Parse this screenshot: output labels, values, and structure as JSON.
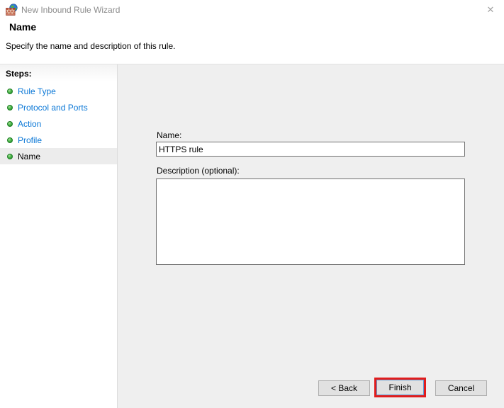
{
  "window": {
    "title": "New Inbound Rule Wizard",
    "close_glyph": "✕"
  },
  "header": {
    "title": "Name",
    "subtitle": "Specify the name and description of this rule."
  },
  "sidebar": {
    "heading": "Steps:",
    "steps": [
      {
        "label": "Rule Type",
        "current": false
      },
      {
        "label": "Protocol and Ports",
        "current": false
      },
      {
        "label": "Action",
        "current": false
      },
      {
        "label": "Profile",
        "current": false
      },
      {
        "label": "Name",
        "current": true
      }
    ]
  },
  "form": {
    "name_label": "Name:",
    "name_value": "HTTPS rule",
    "description_label": "Description (optional):",
    "description_value": ""
  },
  "buttons": {
    "back": "< Back",
    "finish": "Finish",
    "cancel": "Cancel"
  },
  "annotation": {
    "highlight_target": "finish-button",
    "color": "#e11c1c"
  },
  "colors": {
    "step_link_blue": "#0a77d6",
    "step_bullet_green": "#4db44a",
    "panel_gray": "#efefef",
    "current_step_highlight": "#ececec"
  }
}
